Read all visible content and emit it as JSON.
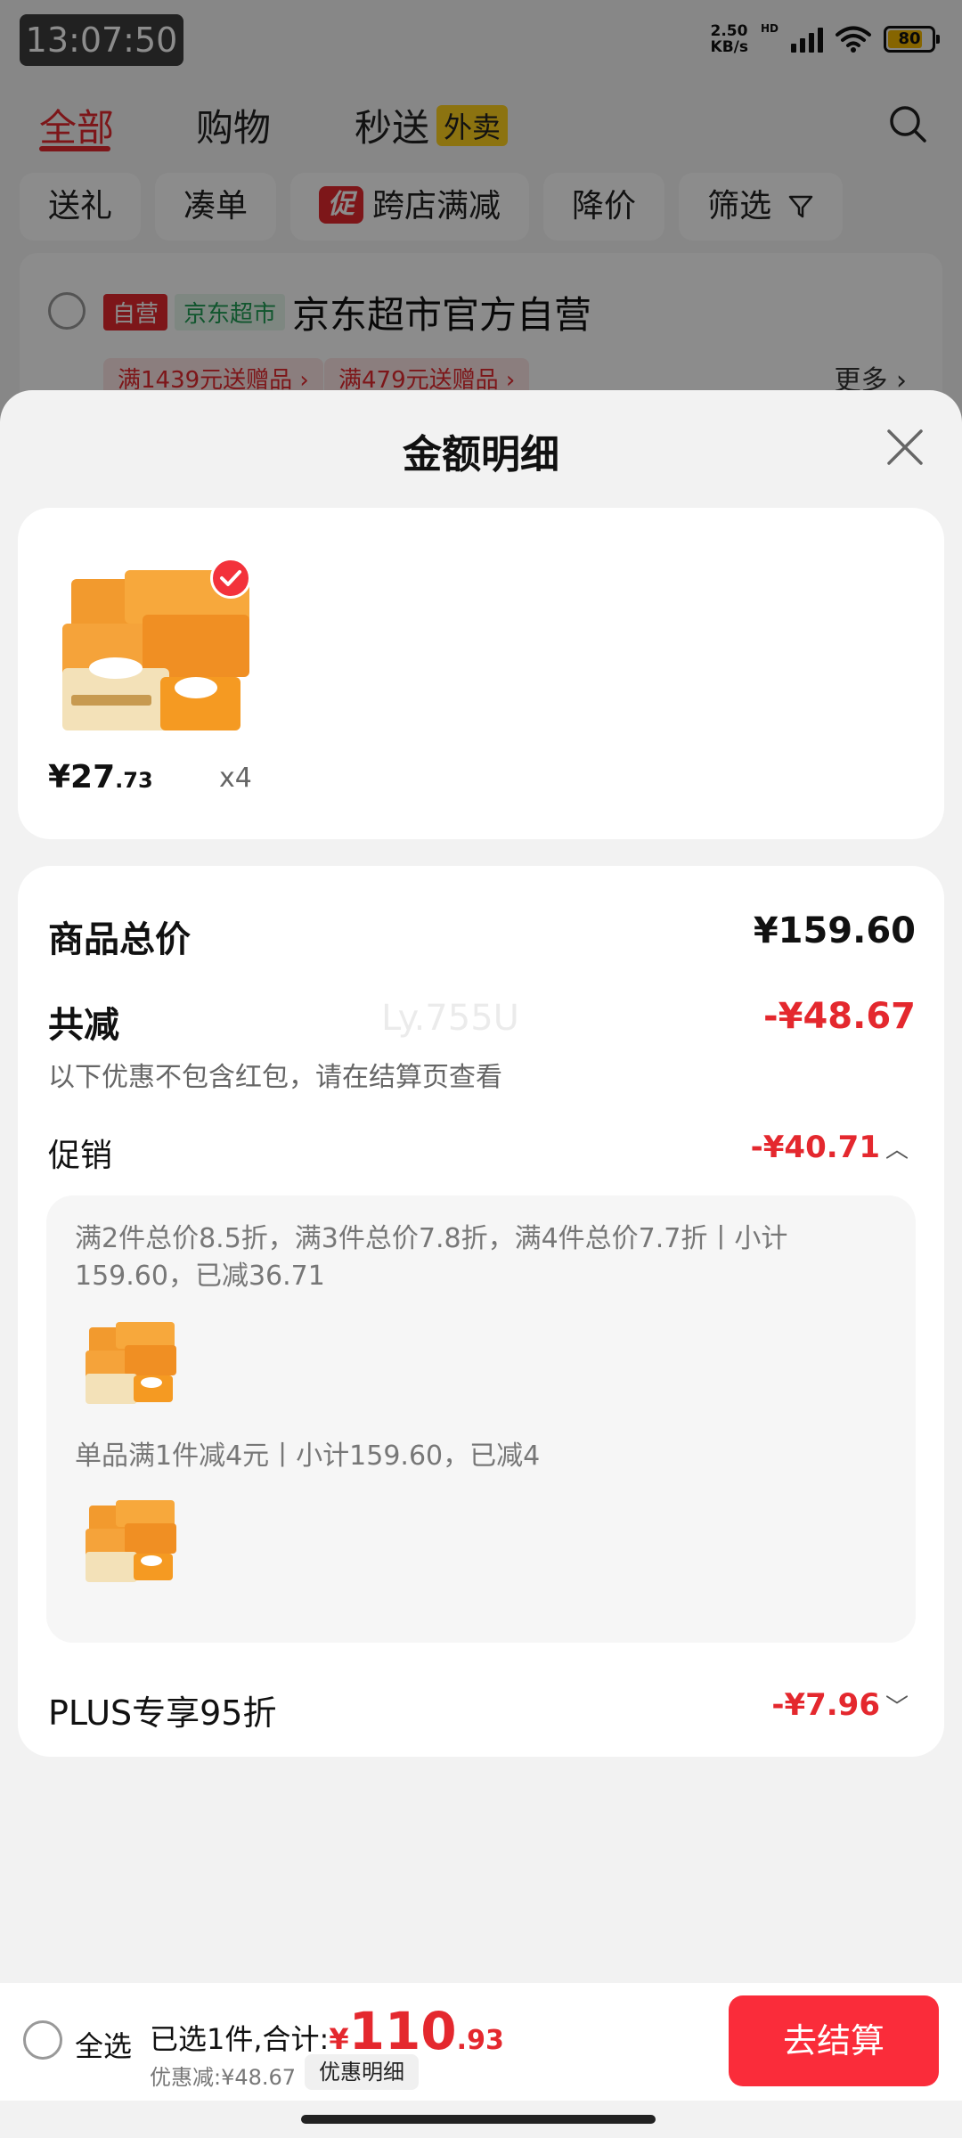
{
  "status_bar": {
    "time": "13:07:50",
    "net_speed_value": "2.50",
    "net_speed_unit": "KB/s",
    "hd_label": "HD",
    "battery": "80"
  },
  "top_tabs": [
    {
      "label": "全部",
      "active": true
    },
    {
      "label": "购物",
      "active": false
    },
    {
      "label": "秒送",
      "badge": "外卖",
      "active": false
    }
  ],
  "filters": {
    "gift": "送礼",
    "combine": "凑单",
    "promo_tag": "促",
    "cross_store": "跨店满减",
    "price_drop": "降价",
    "filter": "筛选"
  },
  "store": {
    "self_tag": "自营",
    "jd_tag": "京东超市",
    "name": "京东超市官方自营",
    "gift1": "满1439元送赠品 ›",
    "gift2": "满479元送赠品 ›",
    "more": "更多 ›"
  },
  "sheet": {
    "title": "金额明细",
    "goods": {
      "price_int": "¥27",
      "price_dec": ".73",
      "qty": "x4"
    },
    "total_label": "商品总价",
    "total_value": "¥159.60",
    "reduce_label": "共减",
    "reduce_value": "-¥48.67",
    "reduce_note": "以下优惠不包含红包，请在结算页查看",
    "watermark": "Ly.755U",
    "promo_label": "促销",
    "promo_value": "-¥40.71",
    "promo_items": [
      {
        "desc": "满2件总价8.5折，满3件总价7.8折，满4件总价7.7折丨小计159.60，已减36.71"
      },
      {
        "desc": "单品满1件减4元丨小计159.60，已减4"
      }
    ],
    "plus_label": "PLUS专享95折",
    "plus_value": "-¥7.96"
  },
  "bottom_bar": {
    "select_all": "全选",
    "summary_prefix": "已选1件,合计:",
    "total_yen": "¥",
    "total_int": "110",
    "total_dec": ".93",
    "discount_text": "优惠减:¥48.67",
    "discount_detail": "优惠明细",
    "checkout": "去结算"
  },
  "colors": {
    "accent": "#e4282e",
    "checkout": "#fa2c3a",
    "sheet_bg": "#f2f2f2"
  }
}
